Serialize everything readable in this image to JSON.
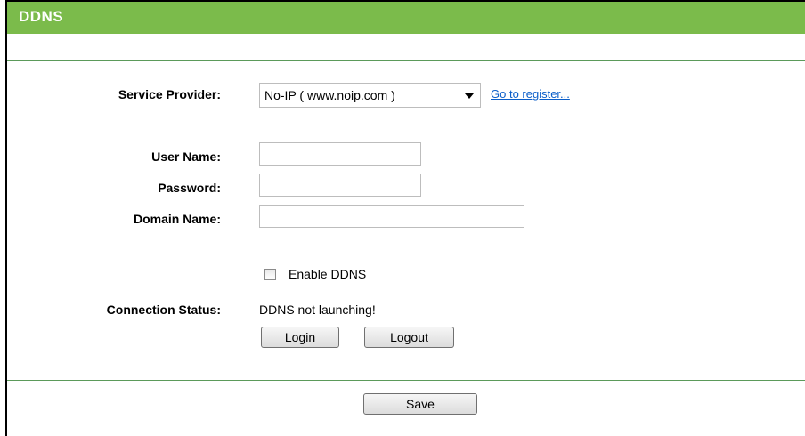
{
  "header": {
    "title": "DDNS"
  },
  "form": {
    "service_provider_label": "Service Provider:",
    "service_provider_value": "No-IP ( www.noip.com )",
    "register_link": "Go to register...",
    "username_label": "User Name:",
    "username_value": "",
    "password_label": "Password:",
    "password_value": "",
    "domain_label": "Domain Name:",
    "domain_value": "",
    "enable_label": "Enable DDNS",
    "enable_checked": false,
    "status_label": "Connection Status:",
    "status_value": "DDNS not launching!",
    "login_label": "Login",
    "logout_label": "Logout"
  },
  "footer": {
    "save_label": "Save"
  },
  "colors": {
    "header_bg": "#7bbb4b",
    "link": "#0b5ec9",
    "rule": "#5b9a5a"
  }
}
